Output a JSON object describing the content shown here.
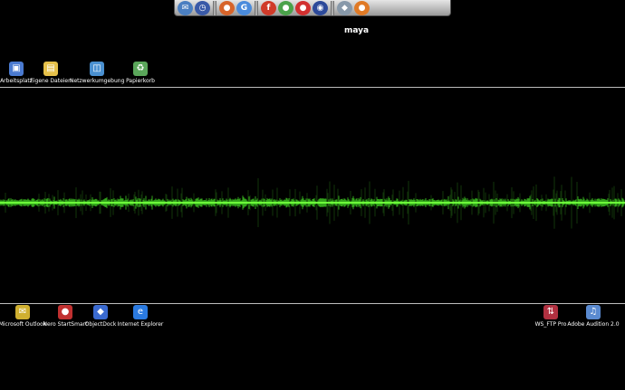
{
  "dock": {
    "items": [
      {
        "icon": "mail-icon",
        "color": "#4b7fc1",
        "glyph": "✉"
      },
      {
        "icon": "clock-icon",
        "color": "#3a5aa8",
        "glyph": "◷"
      },
      {
        "icon": "firefox-icon",
        "color": "#d7642a",
        "glyph": "●"
      },
      {
        "icon": "google-icon",
        "color": "#4a8bdc",
        "glyph": "G"
      },
      {
        "icon": "flash-icon",
        "color": "#d03b2a",
        "glyph": "f"
      },
      {
        "icon": "dreamweaver-icon",
        "color": "#4aa24a",
        "glyph": "●"
      },
      {
        "icon": "acrobat-icon",
        "color": "#d23030",
        "glyph": "●"
      },
      {
        "icon": "maya-icon",
        "color": "#2d4a9a",
        "glyph": "◉"
      },
      {
        "icon": "shield-icon",
        "color": "#8899aa",
        "glyph": "◆"
      },
      {
        "icon": "firefox-icon",
        "color": "#e07a26",
        "glyph": "●"
      }
    ],
    "active_label": "maya"
  },
  "top_icons": [
    {
      "label": "Arbeitsplatz",
      "icon": "my-computer-icon",
      "color": "#4a7ad0",
      "glyph": "▣"
    },
    {
      "label": "Eigene Dateien",
      "icon": "my-documents-icon",
      "color": "#e6c14a",
      "glyph": "▤"
    },
    {
      "label": "Netzwerkumgebung",
      "icon": "network-icon",
      "color": "#4a90d0",
      "glyph": "◫"
    },
    {
      "label": "Papierkorb",
      "icon": "recycle-bin-icon",
      "color": "#5aa65a",
      "glyph": "♻"
    }
  ],
  "bottom_icons": [
    {
      "label": "Microsoft Outlook",
      "icon": "outlook-icon",
      "color": "#d0b030",
      "glyph": "✉"
    },
    {
      "label": "Nero StartSmart",
      "icon": "nero-icon",
      "color": "#c03030",
      "glyph": "●"
    },
    {
      "label": "ObjectDock",
      "icon": "objectdock-icon",
      "color": "#3a6ad0",
      "glyph": "◆"
    },
    {
      "label": "Internet Explorer",
      "icon": "internet-explorer-icon",
      "color": "#2a7ae0",
      "glyph": "e"
    },
    {
      "label": "WS_FTP Pro",
      "icon": "ftp-icon",
      "color": "#b03040",
      "glyph": "⇅"
    },
    {
      "label": "Adobe Audition 2.0",
      "icon": "adobe-audition-icon",
      "color": "#5a8ad0",
      "glyph": "♫"
    }
  ]
}
